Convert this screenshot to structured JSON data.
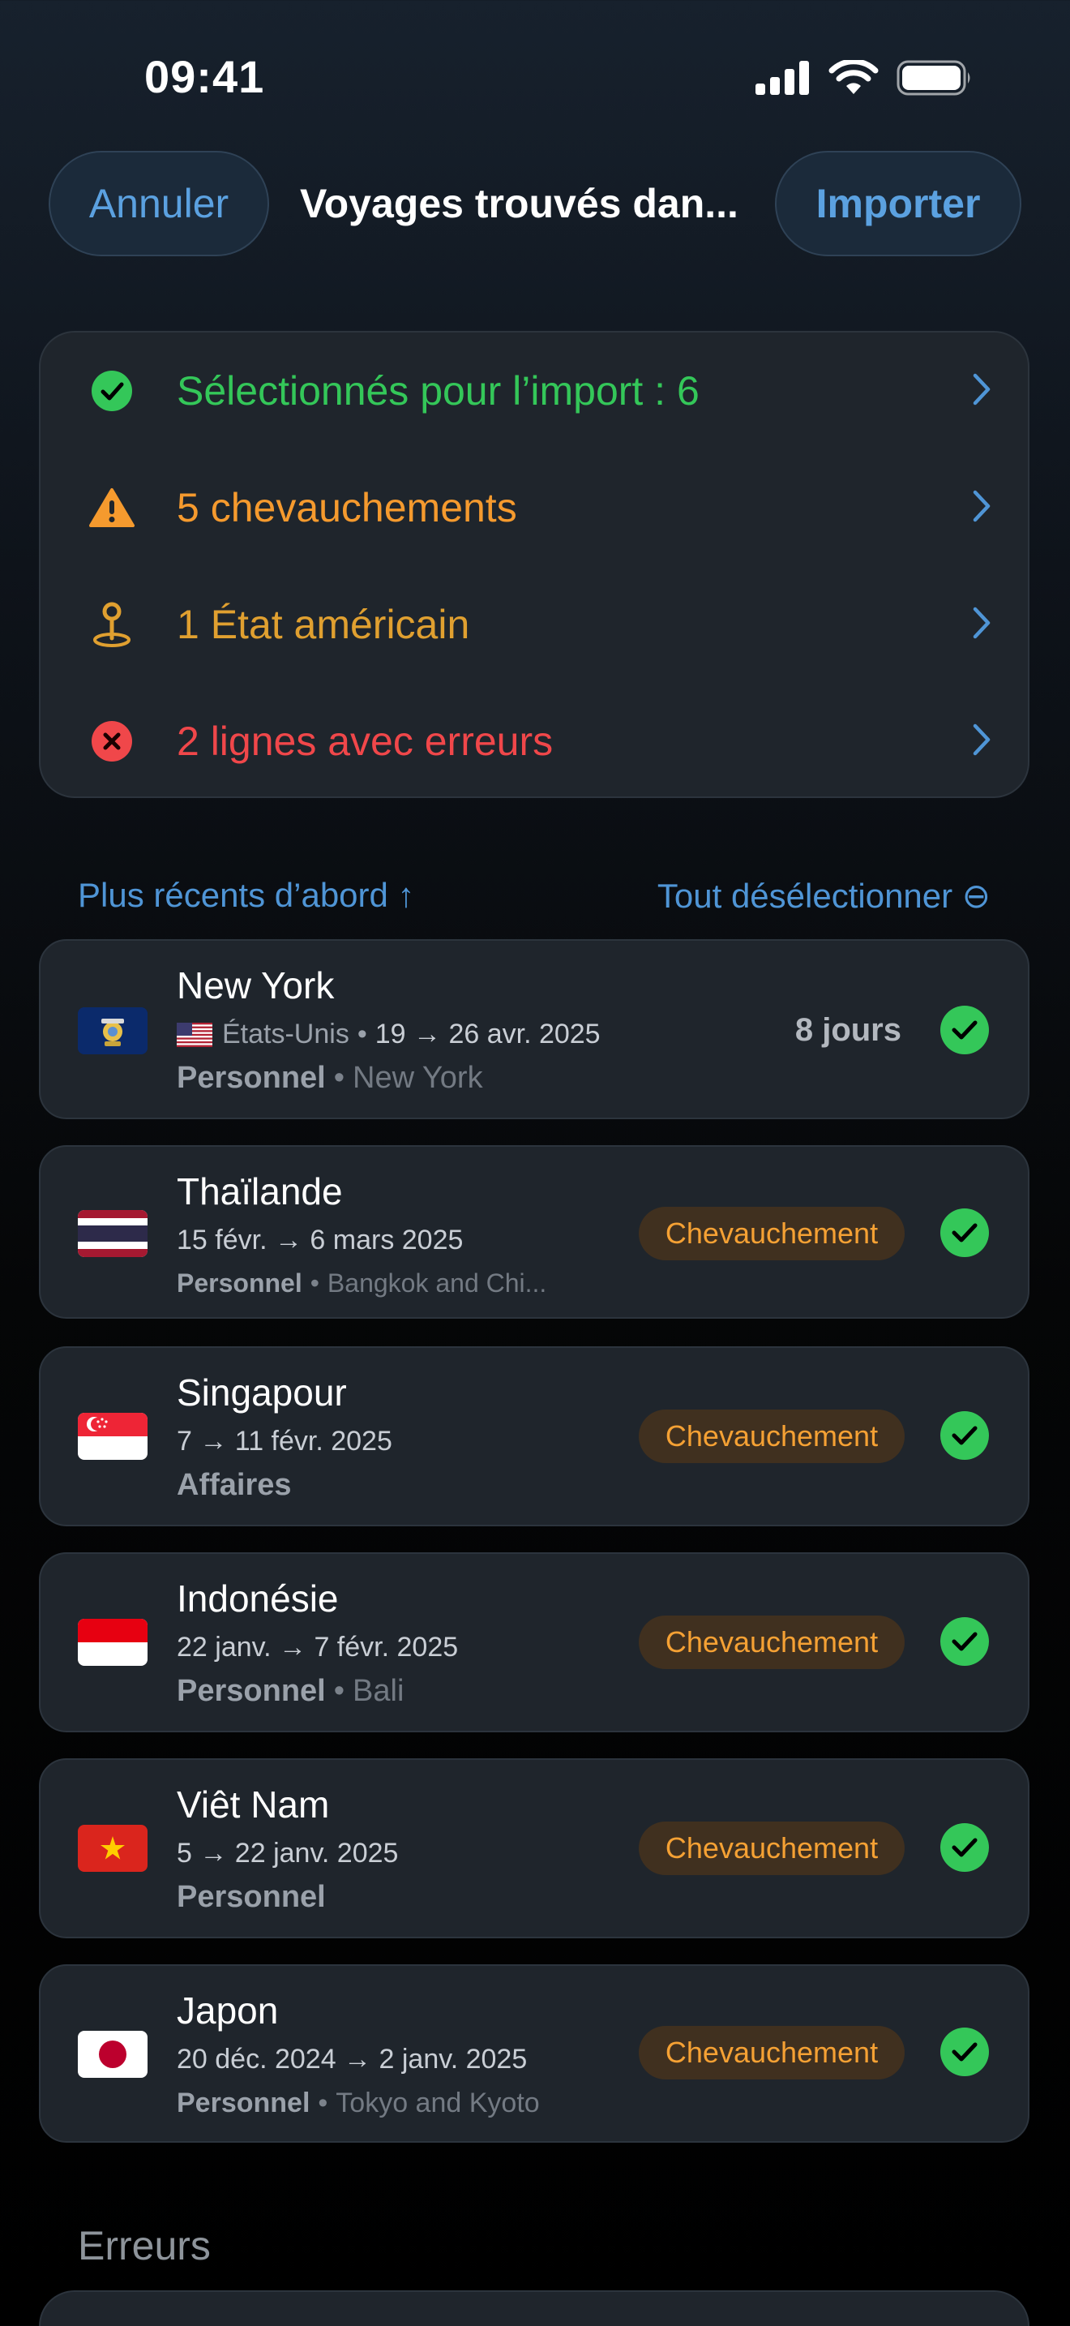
{
  "status_bar": {
    "time": "09:41"
  },
  "nav": {
    "cancel_label": "Annuler",
    "title": "Voyages trouvés dan...",
    "import_label": "Importer"
  },
  "summary": [
    {
      "label": "Sélectionnés pour l’import : 6",
      "color": "#34c759",
      "icon": "checkmark-circle-icon"
    },
    {
      "label": "5 chevauchements",
      "color": "#f59a2e",
      "icon": "warning-triangle-icon"
    },
    {
      "label": "1 État américain",
      "color": "#e0a030",
      "icon": "map-pin-icon"
    },
    {
      "label": "2 lignes avec erreurs",
      "color": "#f0474a",
      "icon": "error-circle-icon"
    }
  ],
  "list_header": {
    "sort_label": "Plus récents d’abord ↑",
    "deselect_label": "Tout désélectionner ⊖"
  },
  "trips": [
    {
      "name": "New York",
      "country": "États-Unis",
      "dates": "19 → 26 avr. 2025",
      "category": "Personnel",
      "place": "New York",
      "duration": "8 jours",
      "flag": "new-york-state-flag",
      "selected": true
    },
    {
      "name": "Thaïlande",
      "dates": "15 févr. → 6 mars 2025",
      "category": "Personnel",
      "place": "Bangkok and Chi...",
      "badge": "Chevauchement",
      "flag": "thailand-flag",
      "selected": true
    },
    {
      "name": "Singapour",
      "dates": "7 → 11 févr. 2025",
      "category": "Affaires",
      "badge": "Chevauchement",
      "flag": "singapore-flag",
      "selected": true
    },
    {
      "name": "Indonésie",
      "dates": "22 janv. → 7 févr. 2025",
      "category": "Personnel",
      "place": "Bali",
      "badge": "Chevauchement",
      "flag": "indonesia-flag",
      "selected": true
    },
    {
      "name": "Viêt Nam",
      "dates": "5 → 22 janv. 2025",
      "category": "Personnel",
      "badge": "Chevauchement",
      "flag": "vietnam-flag",
      "selected": true
    },
    {
      "name": "Japon",
      "dates": "20 déc. 2024 → 2 janv. 2025",
      "category": "Personnel",
      "place": "Tokyo and Kyoto",
      "badge": "Chevauchement",
      "flag": "japan-flag",
      "selected": true
    }
  ],
  "errors_section": {
    "title": "Erreurs"
  },
  "meta_separator": "•",
  "colors": {
    "accent": "#5ba1e0",
    "success": "#34c759",
    "overlap": "#f5a134",
    "error": "#f0474a"
  }
}
